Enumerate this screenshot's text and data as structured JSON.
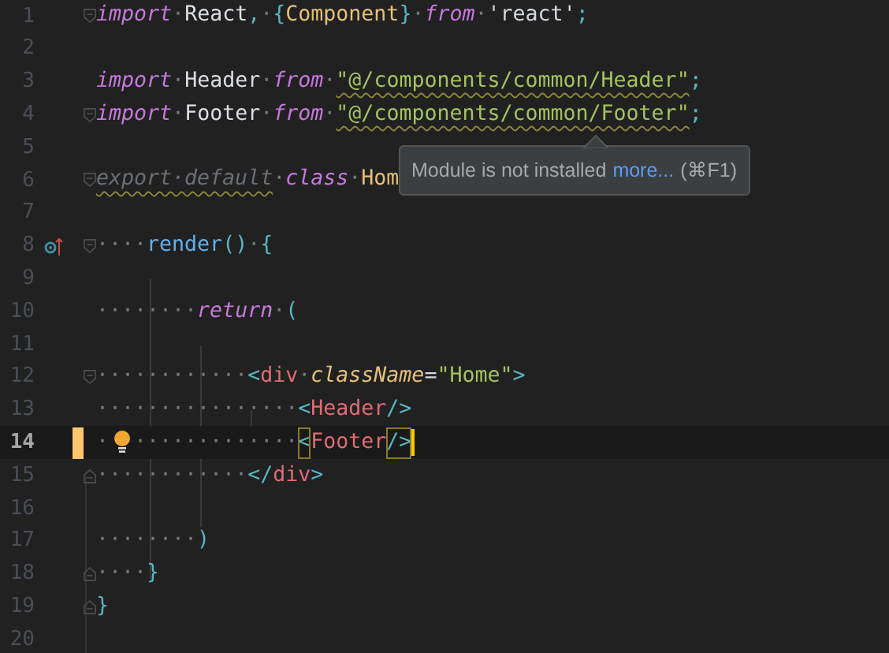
{
  "lines": [
    {
      "number": "1",
      "fold_start": true,
      "tokens": [
        {
          "kind": "keyword",
          "text": "import"
        },
        {
          "kind": "ws",
          "text": "·"
        },
        {
          "kind": "ident",
          "text": "React"
        },
        {
          "kind": "punct",
          "text": ","
        },
        {
          "kind": "ws",
          "text": "·"
        },
        {
          "kind": "punct",
          "text": "{"
        },
        {
          "kind": "type",
          "text": "Component"
        },
        {
          "kind": "punct",
          "text": "}"
        },
        {
          "kind": "ws",
          "text": "·"
        },
        {
          "kind": "keyword",
          "text": "from"
        },
        {
          "kind": "ws",
          "text": "·"
        },
        {
          "kind": "plain",
          "text": "'react'"
        },
        {
          "kind": "punct",
          "text": ";"
        }
      ]
    },
    {
      "number": "2"
    },
    {
      "number": "3",
      "tokens": [
        {
          "kind": "keyword",
          "text": "import"
        },
        {
          "kind": "ws",
          "text": "·"
        },
        {
          "kind": "ident",
          "text": "Header"
        },
        {
          "kind": "ws",
          "text": "·"
        },
        {
          "kind": "keyword",
          "text": "from"
        },
        {
          "kind": "ws",
          "text": "·"
        },
        {
          "kind": "string",
          "text": "\"@/components/common/Header\"",
          "warning": true
        },
        {
          "kind": "punct",
          "text": ";"
        }
      ]
    },
    {
      "number": "4",
      "fold_start": true,
      "tokens": [
        {
          "kind": "keyword",
          "text": "import"
        },
        {
          "kind": "ws",
          "text": "·"
        },
        {
          "kind": "ident",
          "text": "Footer"
        },
        {
          "kind": "ws",
          "text": "·"
        },
        {
          "kind": "keyword",
          "text": "from"
        },
        {
          "kind": "ws",
          "text": "·"
        },
        {
          "kind": "string",
          "text": "\"@/components/common/Footer\"",
          "warning": true
        },
        {
          "kind": "punct",
          "text": ";"
        }
      ]
    },
    {
      "number": "5"
    },
    {
      "number": "6",
      "fold_start": true,
      "tokens": [
        {
          "kind": "dim",
          "text": "export·default",
          "warning": true
        },
        {
          "kind": "ws",
          "text": "·"
        },
        {
          "kind": "keyword",
          "text": "class"
        },
        {
          "kind": "ws",
          "text": "·"
        },
        {
          "kind": "type",
          "text": "Hom"
        }
      ]
    },
    {
      "number": "7"
    },
    {
      "number": "8",
      "fold_start": true,
      "override": true,
      "tokens": [
        {
          "kind": "ws",
          "text": "····"
        },
        {
          "kind": "method",
          "text": "render"
        },
        {
          "kind": "punct",
          "text": "()"
        },
        {
          "kind": "ws",
          "text": "·"
        },
        {
          "kind": "punct",
          "text": "{"
        }
      ]
    },
    {
      "number": "9"
    },
    {
      "number": "10",
      "tokens": [
        {
          "kind": "ws",
          "text": "········"
        },
        {
          "kind": "keyword",
          "text": "return"
        },
        {
          "kind": "ws",
          "text": "·"
        },
        {
          "kind": "punct",
          "text": "("
        }
      ]
    },
    {
      "number": "11"
    },
    {
      "number": "12",
      "fold_start": true,
      "tokens": [
        {
          "kind": "ws",
          "text": "············"
        },
        {
          "kind": "punct",
          "text": "<"
        },
        {
          "kind": "tag",
          "text": "div"
        },
        {
          "kind": "ws",
          "text": "·"
        },
        {
          "kind": "attr",
          "text": "className"
        },
        {
          "kind": "plain",
          "text": "="
        },
        {
          "kind": "string",
          "text": "\"Home\""
        },
        {
          "kind": "punct",
          "text": ">"
        }
      ]
    },
    {
      "number": "13",
      "tokens": [
        {
          "kind": "ws",
          "text": "················"
        },
        {
          "kind": "punct",
          "text": "<"
        },
        {
          "kind": "tag",
          "text": "Header"
        },
        {
          "kind": "punct",
          "text": "/>"
        }
      ]
    },
    {
      "number": "14",
      "current": true,
      "changed": true,
      "cursor": true,
      "tokens": [
        {
          "kind": "ws",
          "text": "·"
        },
        {
          "kind": "bulb"
        },
        {
          "kind": "ws",
          "text": "·············"
        },
        {
          "kind": "punct",
          "text": "<",
          "matched": true
        },
        {
          "kind": "tag",
          "text": "Footer"
        },
        {
          "kind": "punct",
          "text": "/>",
          "matched": true
        }
      ]
    },
    {
      "number": "15",
      "fold_end": true,
      "tokens": [
        {
          "kind": "ws",
          "text": "············"
        },
        {
          "kind": "punct",
          "text": "</"
        },
        {
          "kind": "tag",
          "text": "div"
        },
        {
          "kind": "punct",
          "text": ">"
        }
      ]
    },
    {
      "number": "16"
    },
    {
      "number": "17",
      "tokens": [
        {
          "kind": "ws",
          "text": "········"
        },
        {
          "kind": "punct",
          "text": ")"
        }
      ]
    },
    {
      "number": "18",
      "fold_end": true,
      "tokens": [
        {
          "kind": "ws",
          "text": "····"
        },
        {
          "kind": "punct",
          "text": "}"
        }
      ]
    },
    {
      "number": "19",
      "fold_end": true,
      "tokens": [
        {
          "kind": "punct",
          "text": "}"
        }
      ]
    },
    {
      "number": "20"
    }
  ],
  "tooltip": {
    "message": "Module is not installed",
    "link": "more...",
    "shortcut": "(⌘F1)"
  }
}
